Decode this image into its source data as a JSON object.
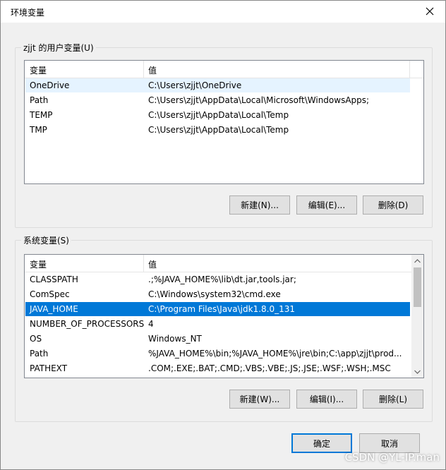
{
  "window": {
    "title": "环境变量"
  },
  "user_group": {
    "label": "zjjt 的用户变量(U)",
    "columns": [
      "变量",
      "值"
    ],
    "rows": [
      {
        "name": "OneDrive",
        "value": "C:\\Users\\zjjt\\OneDrive"
      },
      {
        "name": "Path",
        "value": "C:\\Users\\zjjt\\AppData\\Local\\Microsoft\\WindowsApps;"
      },
      {
        "name": "TEMP",
        "value": "C:\\Users\\zjjt\\AppData\\Local\\Temp"
      },
      {
        "name": "TMP",
        "value": "C:\\Users\\zjjt\\AppData\\Local\\Temp"
      }
    ],
    "buttons": {
      "new": "新建(N)...",
      "edit": "编辑(E)...",
      "delete": "删除(D)"
    }
  },
  "system_group": {
    "label": "系统变量(S)",
    "columns": [
      "变量",
      "值"
    ],
    "rows": [
      {
        "name": "CLASSPATH",
        "value": ".;%JAVA_HOME%\\lib\\dt.jar,tools.jar;"
      },
      {
        "name": "ComSpec",
        "value": "C:\\Windows\\system32\\cmd.exe"
      },
      {
        "name": "JAVA_HOME",
        "value": "C:\\Program Files\\Java\\jdk1.8.0_131"
      },
      {
        "name": "NUMBER_OF_PROCESSORS",
        "value": "4"
      },
      {
        "name": "OS",
        "value": "Windows_NT"
      },
      {
        "name": "Path",
        "value": "%JAVA_HOME%\\bin;%JAVA_HOME%\\jre\\bin;C:\\app\\zjjt\\prod..."
      },
      {
        "name": "PATHEXT",
        "value": ".COM;.EXE;.BAT;.CMD;.VBS;.VBE;.JS;.JSE;.WSF;.WSH;.MSC"
      }
    ],
    "selected_row": "JAVA_HOME",
    "buttons": {
      "new": "新建(W)...",
      "edit": "编辑(I)...",
      "delete": "删除(L)"
    }
  },
  "footer": {
    "ok": "确定",
    "cancel": "取消"
  },
  "watermark": "CSDN @YL-IP.man",
  "colors": {
    "selection": "#0078d7",
    "hover": "#e5f3ff",
    "ok_border": "#0078d7"
  }
}
